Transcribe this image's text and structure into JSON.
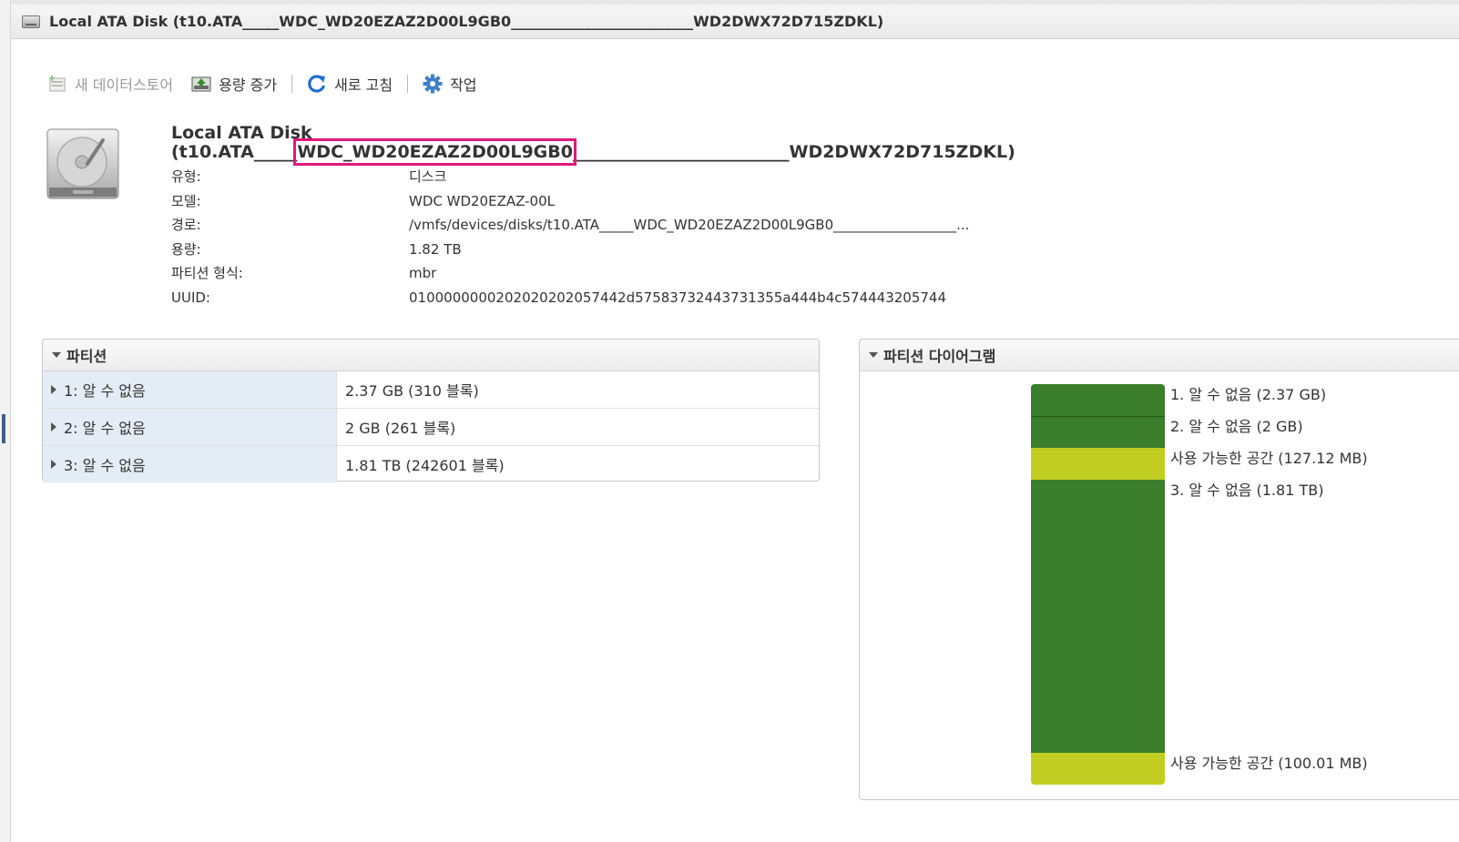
{
  "window": {
    "title": "Local ATA Disk (t10.ATA_____WDC_WD20EZAZ2D00L9GB0_________________________WD2DWX72D715ZDKL)"
  },
  "toolbar": {
    "new_datastore": "새 데이터스토어",
    "increase_capacity": "용량 증가",
    "refresh": "새로 고침",
    "actions": "작업"
  },
  "disk": {
    "name_line1": "Local ATA Disk",
    "name_prefix": "(t10.ATA_____",
    "name_highlight": "WDC_WD20EZAZ2D00L9GB0",
    "name_suffix": "_________________________WD2DWX72D715ZDKL)",
    "highlight_color": "#e0197d"
  },
  "props": [
    {
      "key": "유형:",
      "value": "디스크"
    },
    {
      "key": "모델:",
      "value": "WDC WD20EZAZ-00L"
    },
    {
      "key": "경로:",
      "value": "/vmfs/devices/disks/t10.ATA_____WDC_WD20EZAZ2D00L9GB0__________________..."
    },
    {
      "key": "용량:",
      "value": "1.82 TB"
    },
    {
      "key": "파티션 형식:",
      "value": "mbr"
    },
    {
      "key": "UUID:",
      "value": "0100000000202020202057442d57583732443731355a444b4c574443205744"
    }
  ],
  "partitions": {
    "title": "파티션",
    "rows": [
      {
        "name": "1: 알 수 없음",
        "value": "2.37 GB (310 블록)"
      },
      {
        "name": "2: 알 수 없음",
        "value": "2 GB (261 블록)"
      },
      {
        "name": "3: 알 수 없음",
        "value": "1.81 TB (242601 블록)"
      }
    ]
  },
  "diagram": {
    "title": "파티션 다이어그램",
    "used_color": "#3a7d2b",
    "free_color": "#c2cf22",
    "segments": [
      {
        "label": "1. 알 수 없음  (2.37 GB)",
        "kind": "used"
      },
      {
        "label": "2. 알 수 없음  (2 GB)",
        "kind": "used"
      },
      {
        "label": "사용 가능한 공간  (127.12 MB)",
        "kind": "free"
      },
      {
        "label": "3. 알 수 없음  (1.81 TB)",
        "kind": "used"
      },
      {
        "label": "사용 가능한 공간  (100.01 MB)",
        "kind": "free"
      }
    ]
  }
}
